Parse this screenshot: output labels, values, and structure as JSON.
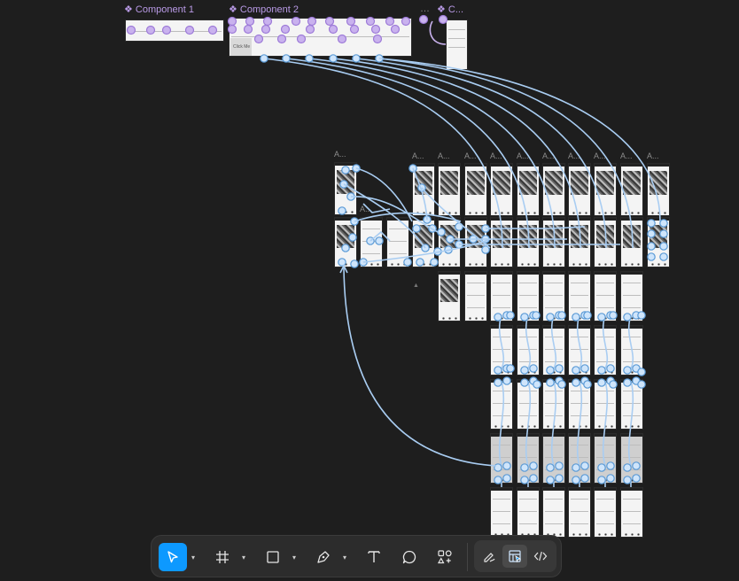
{
  "canvas": {
    "components": [
      {
        "label": "❖ Component 1"
      },
      {
        "label": "❖ Component 2"
      },
      {
        "label": "…"
      },
      {
        "label": "❖ C..."
      }
    ],
    "frame_labels": [
      "A...",
      "A...",
      "A...",
      "A...",
      "A...",
      "A...",
      "A...",
      "A...",
      "A...",
      "A...",
      "A...",
      "A..."
    ],
    "placeholder_text": [
      "Click Me",
      "Click Me"
    ]
  },
  "toolbar": {
    "tools": [
      {
        "name": "move",
        "icon": "cursor-arrow-icon",
        "active": true
      },
      {
        "name": "frame",
        "icon": "hash-frame-icon",
        "active": false
      },
      {
        "name": "shape",
        "icon": "rectangle-icon",
        "active": false
      },
      {
        "name": "pen",
        "icon": "pen-icon",
        "active": false
      },
      {
        "name": "text",
        "icon": "text-icon",
        "active": false
      },
      {
        "name": "comment",
        "icon": "comment-bubble-icon",
        "active": false
      },
      {
        "name": "actions",
        "icon": "shapes-plus-icon",
        "active": false
      }
    ],
    "caret_glyph": "▾",
    "modes": [
      {
        "name": "draw",
        "icon": "pencil-scribble-icon",
        "active": false
      },
      {
        "name": "design",
        "icon": "layout-cursor-icon",
        "active": true
      },
      {
        "name": "dev",
        "icon": "code-brackets-icon",
        "active": false
      }
    ]
  }
}
